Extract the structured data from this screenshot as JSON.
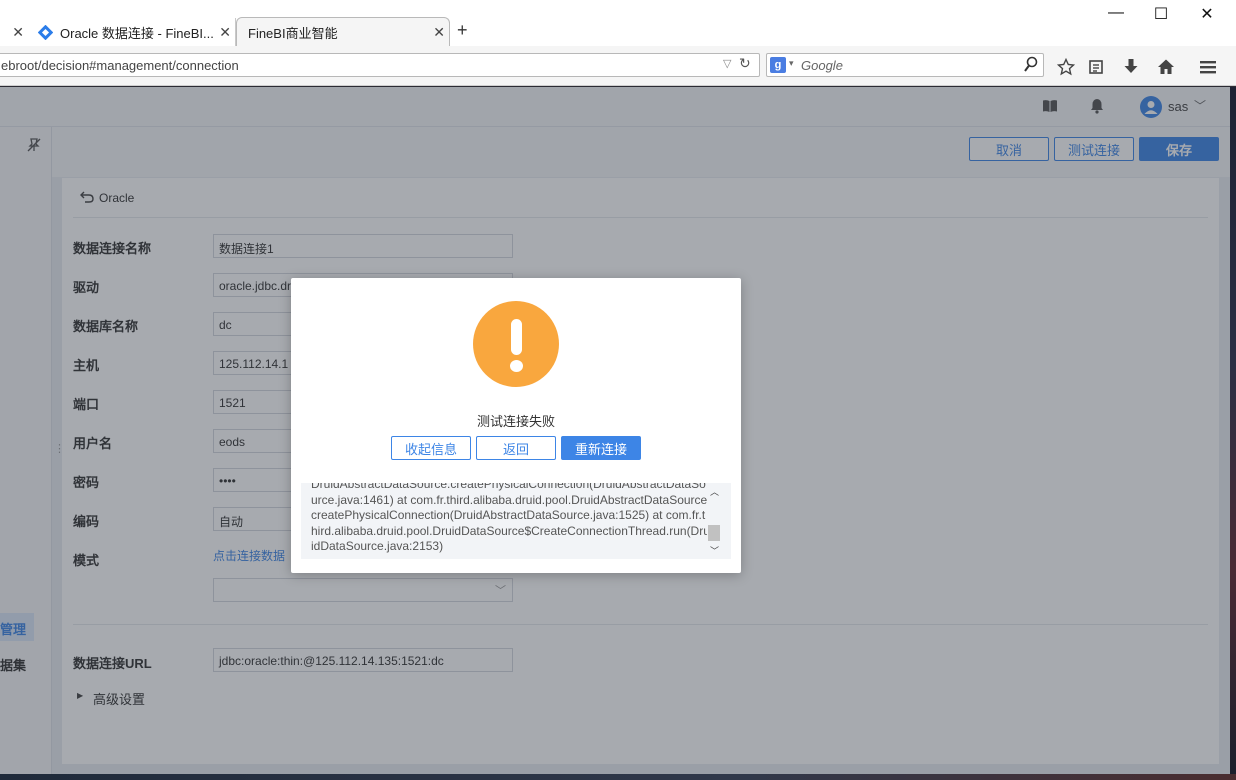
{
  "browser": {
    "tabs": [
      {
        "title": "Oracle 数据连接 - FineBI..."
      },
      {
        "title": "FineBI商业智能"
      }
    ],
    "url": "ebroot/decision#management/connection",
    "search_placeholder": "Google"
  },
  "header": {
    "username": "sas"
  },
  "sidebar": {
    "items": [
      "管理",
      "据集"
    ]
  },
  "toolbar": {
    "cancel": "取消",
    "test": "测试连接",
    "save": "保存"
  },
  "page": {
    "back_label": "Oracle"
  },
  "form": {
    "fields": [
      {
        "label": "数据连接名称",
        "value": "数据连接1"
      },
      {
        "label": "驱动",
        "value": "oracle.jdbc.dr"
      },
      {
        "label": "数据库名称",
        "value": "dc"
      },
      {
        "label": "主机",
        "value": "125.112.14.1"
      },
      {
        "label": "端口",
        "value": "1521"
      },
      {
        "label": "用户名",
        "value": "eods"
      },
      {
        "label": "密码",
        "value": "••••"
      },
      {
        "label": "编码",
        "value": "自动"
      },
      {
        "label": "模式",
        "value": "点击连接数据"
      }
    ],
    "url_label": "数据连接URL",
    "url_value": "jdbc:oracle:thin:@125.112.14.135:1521:dc",
    "advanced": "高级设置"
  },
  "modal": {
    "message": "测试连接失败",
    "collapse": "收起信息",
    "back": "返回",
    "reconnect": "重新连接",
    "error_text": "DruidAbstractDataSource.createPhysicalConnection(DruidAbstractDataSource.java:1461)   at com.fr.third.alibaba.druid.pool.DruidAbstractDataSource.createPhysicalConnection(DruidAbstractDataSource.java:1525)   at com.fr.third.alibaba.druid.pool.DruidDataSource$CreateConnectionThread.run(DruidDataSource.java:2153)"
  },
  "colors": {
    "accent": "#3d85e6",
    "warning": "#f9a73e"
  }
}
